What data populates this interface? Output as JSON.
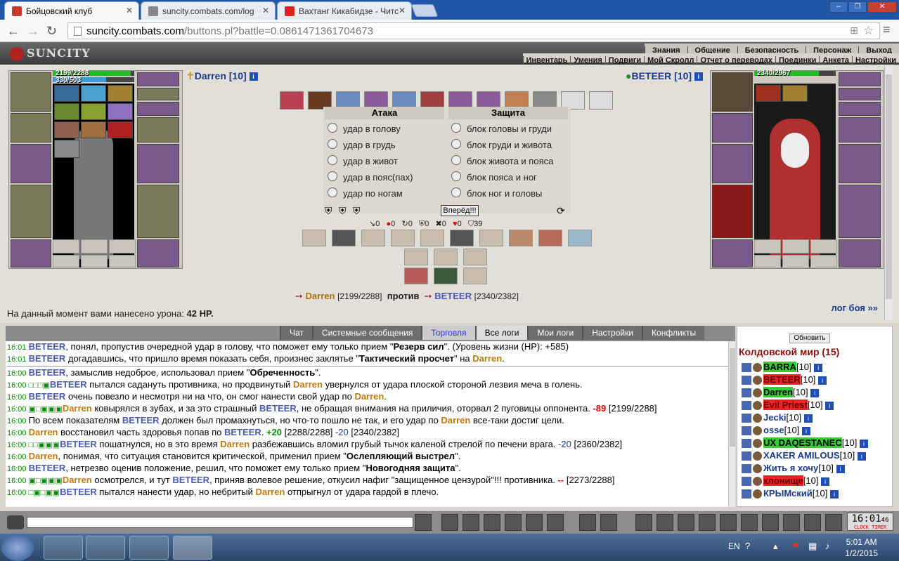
{
  "browser": {
    "tabs": [
      {
        "label": "Бойцовский клуб",
        "color": "#c63a2a"
      },
      {
        "label": "suncity.combats.com/log",
        "color": "#666"
      },
      {
        "label": "Вахтанг Кикабидзе - Читс",
        "color": "#e02020"
      }
    ],
    "url_host": "suncity.combats.com",
    "url_path": "/buttons.pl?battle=0.0861471361704673"
  },
  "game": {
    "logo": "SUNCITY",
    "menu_top": [
      "Знания",
      "Общение",
      "Безопасность",
      "Персонаж",
      "Выход"
    ],
    "menu_sub": [
      "Инвентарь",
      "Умения",
      "Подвиги",
      "Мой Скролл",
      "Отчет о переводах",
      "Поединки",
      "Анкета",
      "Настройки"
    ]
  },
  "left": {
    "name": "Darren [10]",
    "hp_text": "2199/2288",
    "mana_text": "330/503",
    "hp": 0.961,
    "mana": 0.656
  },
  "right": {
    "name": "BETEER [10]",
    "hp_text": "2340/2967",
    "hp": 0.789
  },
  "attack": {
    "title": "Атака",
    "options": [
      "удар в голову",
      "удар в грудь",
      "удар в живот",
      "удар в пояс(пах)",
      "удар по ногам"
    ]
  },
  "defense": {
    "title": "Защита",
    "options": [
      "блок головы и груди",
      "блок груди и живота",
      "блок живота и пояса",
      "блок пояса и ног",
      "блок ног и головы"
    ]
  },
  "forward_label": "Вперёд!!!",
  "stats": [
    "0",
    "0",
    "0",
    "0",
    "0",
    "0",
    "39"
  ],
  "versus": {
    "left_name": "Darren",
    "left_hp": "[2199/2288]",
    "vs": "против",
    "right_name": "BETEER",
    "right_hp": "[2340/2382]"
  },
  "damage_prefix": "На данный момент вами нанесено урона:",
  "damage_value": "42 HP.",
  "log_link": "лог боя »»",
  "chat_tabs": [
    "Чат",
    "Системные сообщения",
    "Торговля",
    "Все логи",
    "Мои логи",
    "Настройки",
    "Конфликты"
  ],
  "chat_lines": [
    [
      [
        "t",
        "16:01 "
      ],
      [
        "b",
        "BETEER"
      ],
      [
        "n",
        ", понял, пропустив очередной удар в голову, что поможет ему только прием \""
      ],
      [
        "k",
        "Резерв сил"
      ],
      [
        "n",
        "\". (Уровень жизни (HP): +585)"
      ]
    ],
    [
      [
        "t",
        "16:01 "
      ],
      [
        "b",
        "BETEER"
      ],
      [
        "n",
        " догадавшись, что пришло время показать себя, произнес заклятье \""
      ],
      [
        "k",
        "Тактический просчет"
      ],
      [
        "n",
        "\" на "
      ],
      [
        "d",
        "Darren"
      ],
      [
        "n",
        "."
      ]
    ],
    [
      [
        "t",
        "16:00 "
      ],
      [
        "b",
        "BETEER"
      ],
      [
        "n",
        ", замыслив недоброе, использовал прием \""
      ],
      [
        "k",
        "Обреченность"
      ],
      [
        "n",
        "\"."
      ]
    ],
    [
      [
        "t",
        "16:00 □□□▣"
      ],
      [
        "b",
        "BETEER"
      ],
      [
        "n",
        " пытался садануть противника, но продвинутый "
      ],
      [
        "d",
        "Darren"
      ],
      [
        "n",
        " увернулся от удара плоской стороной лезвия меча в голень."
      ]
    ],
    [
      [
        "t",
        "16:00 "
      ],
      [
        "b",
        "BETEER"
      ],
      [
        "n",
        " очень повезло и несмотря ни на что, он смог нанести свой удар по "
      ],
      [
        "d",
        "Darren"
      ],
      [
        "n",
        "."
      ]
    ],
    [
      [
        "t",
        "16:00 ▣□▣▣▣"
      ],
      [
        "d",
        "Darren"
      ],
      [
        "n",
        " ковырялся в зубах, и за это страшный "
      ],
      [
        "b",
        "BETEER"
      ],
      [
        "n",
        ", не обращая внимания на приличия, оторвал 2 пуговицы оппонента. "
      ],
      [
        "r",
        "-89"
      ],
      [
        "n",
        " [2199/2288]"
      ]
    ],
    [
      [
        "t",
        "16:00 "
      ],
      [
        "n",
        "По всем показателям "
      ],
      [
        "b",
        "BETEER"
      ],
      [
        "n",
        " должен был промахнуться, но что-то пошло не так, и его удар по "
      ],
      [
        "d",
        "Darren"
      ],
      [
        "n",
        " все-таки достиг цели."
      ]
    ],
    [
      [
        "t",
        "16:00 "
      ],
      [
        "d",
        "Darren"
      ],
      [
        "n",
        " восстановил часть здоровья попав по "
      ],
      [
        "b",
        "BETEER"
      ],
      [
        "n",
        ". "
      ],
      [
        "g",
        "+20"
      ],
      [
        "n",
        " [2288/2288] "
      ],
      [
        "bl",
        "-20"
      ],
      [
        "n",
        " [2340/2382]"
      ]
    ],
    [
      [
        "t",
        "16:00 □□▣▣▣"
      ],
      [
        "b",
        "BETEER"
      ],
      [
        "n",
        " пошатнулся, но в это время "
      ],
      [
        "d",
        "Darren"
      ],
      [
        "n",
        " разбежавшись вломил грубый тычок каленой стрелой по печени врага. "
      ],
      [
        "bl",
        "-20"
      ],
      [
        "n",
        " [2360/2382]"
      ]
    ],
    [
      [
        "t",
        "16:00 "
      ],
      [
        "d",
        "Darren"
      ],
      [
        "n",
        ", понимая, что ситуация становится критической, применил прием \""
      ],
      [
        "k",
        "Ослепляющий выстрел"
      ],
      [
        "n",
        "\"."
      ]
    ],
    [
      [
        "t",
        "16:00 "
      ],
      [
        "b",
        "BETEER"
      ],
      [
        "n",
        ", нетрезво оценив положение, решил, что поможет ему только прием \""
      ],
      [
        "k",
        "Новогодняя защита"
      ],
      [
        "n",
        "\"."
      ]
    ],
    [
      [
        "t",
        "16:00 ▣□▣▣▣"
      ],
      [
        "d",
        "Darren"
      ],
      [
        "n",
        " осмотрелся, и тут "
      ],
      [
        "b",
        "BETEER"
      ],
      [
        "n",
        ", приняв волевое решение, откусил нафиг \"защищенное цензурой\"!!! противника. "
      ],
      [
        "r",
        "--"
      ],
      [
        "n",
        " [2273/2288]"
      ]
    ],
    [
      [
        "t",
        "16:00 □▣□▣▣"
      ],
      [
        "b",
        "BETEER"
      ],
      [
        "n",
        " пытался нанести удар, но небритый "
      ],
      [
        "d",
        "Darren"
      ],
      [
        "n",
        " отпрыгнул от удара гардой в плечо."
      ]
    ]
  ],
  "side": {
    "refresh": "Обновить",
    "world": "Колдовской мир (15)",
    "users": [
      {
        "name": "BARRA",
        "lvl": "[10]",
        "bg": "#3c3",
        "fg": "#000"
      },
      {
        "name": "BETEER",
        "lvl": "[10]",
        "bg": "#e22",
        "fg": "#600"
      },
      {
        "name": "Darren",
        "lvl": "[10]",
        "bg": "#3c3",
        "fg": "#000"
      },
      {
        "name": "Evil Priest",
        "lvl": "[10]",
        "bg": "#e22",
        "fg": "#600"
      },
      {
        "name": "Jecki",
        "lvl": "[10]",
        "bg": "",
        "fg": "#1b3a8a"
      },
      {
        "name": "osse",
        "lvl": "[10]",
        "bg": "",
        "fg": "#1b3a8a"
      },
      {
        "name": "UX DAQESTANEC",
        "lvl": "[10]",
        "bg": "#3c3",
        "fg": "#000"
      },
      {
        "name": "XAKER AMILOUS",
        "lvl": "[10]",
        "bg": "",
        "fg": "#1b3a8a"
      },
      {
        "name": "Жить я хочу",
        "lvl": "[10]",
        "bg": "",
        "fg": "#1b3a8a"
      },
      {
        "name": "клонище",
        "lvl": "[10]",
        "bg": "#e22",
        "fg": "#600"
      },
      {
        "name": "КРЫМский",
        "lvl": "[10]",
        "bg": "",
        "fg": "#1b3a8a"
      }
    ]
  },
  "clock": {
    "time": "16:01",
    "sec": "46",
    "label": "CLOCK TIMER"
  },
  "taskbar": {
    "lang": "EN",
    "time": "5:01 AM",
    "date": "1/2/2015"
  }
}
